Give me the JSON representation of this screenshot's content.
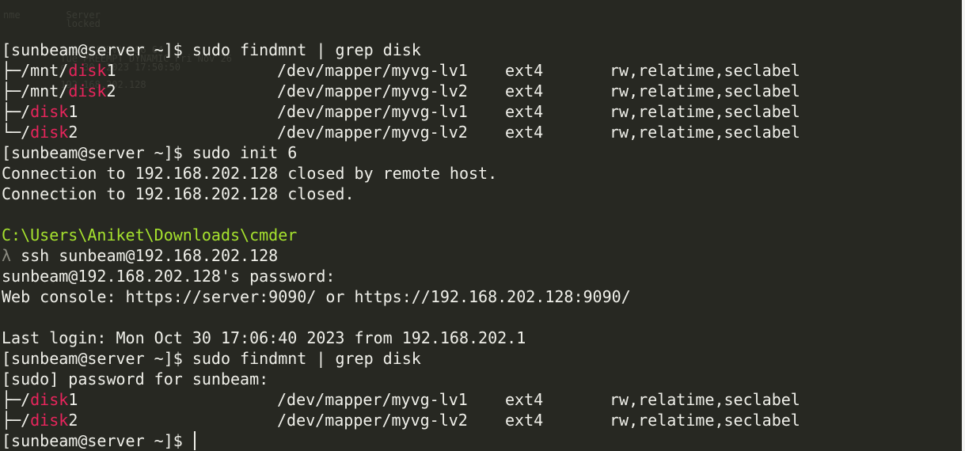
{
  "ghost_text": [
    "nme        Server",
    "           locked",
    "",
    "",
    "          S.0.1 (CSV) x86_64",
    "          Tue PREEMPT_DYNAMIC Fri Nov 26",
    "          e 1 30  2023 17:50:50",
    "",
    "          192.168.202.128"
  ],
  "prompt": "[sunbeam@server ~]$ ",
  "cmd_findmnt": "sudo findmnt | grep disk",
  "cmd_init": "sudo init 6",
  "findmnt_1": [
    {
      "tree": "├─",
      "prefix": "/mnt/",
      "match": "disk",
      "suffix": "1",
      "source": "/dev/mapper/myvg-lv1",
      "fstype": "ext4",
      "options": "rw,relatime,seclabel"
    },
    {
      "tree": "├─",
      "prefix": "/mnt/",
      "match": "disk",
      "suffix": "2",
      "source": "/dev/mapper/myvg-lv2",
      "fstype": "ext4",
      "options": "rw,relatime,seclabel"
    },
    {
      "tree": "├─",
      "prefix": "/",
      "match": "disk",
      "suffix": "1",
      "source": "/dev/mapper/myvg-lv1",
      "fstype": "ext4",
      "options": "rw,relatime,seclabel"
    },
    {
      "tree": "└─",
      "prefix": "/",
      "match": "disk",
      "suffix": "2",
      "source": "/dev/mapper/myvg-lv2",
      "fstype": "ext4",
      "options": "rw,relatime,seclabel"
    }
  ],
  "conn_closed_remote": "Connection to 192.168.202.128 closed by remote host.",
  "conn_closed": "Connection to 192.168.202.128 closed.",
  "cmder_path": "C:\\Users\\Aniket\\Downloads\\cmder",
  "lambda": "λ",
  "ssh_cmd": " ssh sunbeam@192.168.202.128",
  "password_prompt": "sunbeam@192.168.202.128's password:",
  "web_console": "Web console: https://server:9090/ or https://192.168.202.128:9090/",
  "last_login": "Last login: Mon Oct 30 17:06:40 2023 from 192.168.202.1",
  "sudo_password": "[sudo] password for sunbeam:",
  "findmnt_2": [
    {
      "tree": "├─",
      "prefix": "/",
      "match": "disk",
      "suffix": "1",
      "source": "/dev/mapper/myvg-lv1",
      "fstype": "ext4",
      "options": "rw,relatime,seclabel"
    },
    {
      "tree": "├─",
      "prefix": "/",
      "match": "disk",
      "suffix": "2",
      "source": "/dev/mapper/myvg-lv2",
      "fstype": "ext4",
      "options": "rw,relatime,seclabel"
    }
  ],
  "colors": {
    "background": "#272822",
    "text": "#f0f0ea",
    "highlight": "#e8255c",
    "path": "#a6e22e",
    "lambda": "#8a8a80"
  }
}
